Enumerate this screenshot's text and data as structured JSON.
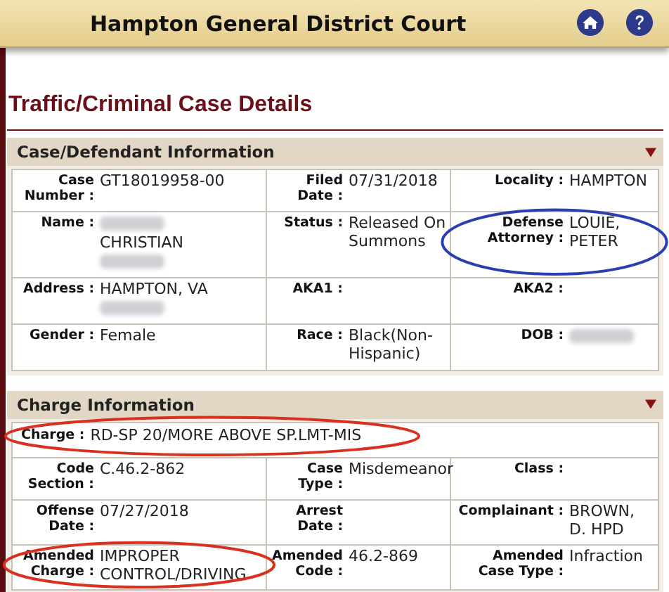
{
  "header": {
    "title": "Hampton General District Court"
  },
  "page_title": "Traffic/Criminal Case Details",
  "sections": [
    {
      "title": "Case/Defendant Information",
      "rows": [
        [
          {
            "label": "Case Number :",
            "value": [
              {
                "kind": "text",
                "text": "GT18019958-00"
              }
            ]
          },
          {
            "label": "Filed Date :",
            "value": [
              {
                "kind": "text",
                "text": "07/31/2018"
              }
            ]
          },
          {
            "label": "Locality :",
            "value": [
              {
                "kind": "text",
                "text": "HAMPTON"
              }
            ]
          }
        ],
        [
          {
            "label": "Name :",
            "value": [
              {
                "kind": "redacted"
              },
              {
                "kind": "text",
                "text": "CHRISTIAN"
              },
              {
                "kind": "redacted"
              }
            ]
          },
          {
            "label": "Status :",
            "value": [
              {
                "kind": "text",
                "text": "Released On Summons"
              }
            ]
          },
          {
            "label": "Defense Attorney :",
            "value": [
              {
                "kind": "text",
                "text": "LOUIE, PETER"
              }
            ],
            "circle": {
              "color": "#2b3fb0"
            }
          }
        ],
        [
          {
            "label": "Address :",
            "value": [
              {
                "kind": "text",
                "text": "HAMPTON, VA"
              },
              {
                "kind": "redacted"
              }
            ]
          },
          {
            "label": "AKA1 :"
          },
          {
            "label": "AKA2 :"
          }
        ],
        [
          {
            "label": "Gender :",
            "value": [
              {
                "kind": "text",
                "text": "Female"
              }
            ]
          },
          {
            "label": "Race :",
            "value": [
              {
                "kind": "text",
                "text": "Black(Non-Hispanic)"
              }
            ]
          },
          {
            "label": "DOB :",
            "value": [
              {
                "kind": "redacted"
              }
            ]
          }
        ]
      ]
    },
    {
      "title": "Charge Information",
      "charge": {
        "label": "Charge :",
        "value": [
          {
            "kind": "text",
            "text": "RD-SP 20/MORE ABOVE SP.LMT-MIS"
          }
        ],
        "circle": {
          "color": "#d9301f"
        }
      },
      "rows": [
        [
          {
            "label": "Code Section :",
            "value": [
              {
                "kind": "text",
                "text": "C.46.2-862"
              }
            ]
          },
          {
            "label": "Case Type :",
            "value": [
              {
                "kind": "text",
                "text": "Misdemeanor"
              }
            ]
          },
          {
            "label": "Class :"
          }
        ],
        [
          {
            "label": "Offense Date :",
            "value": [
              {
                "kind": "text",
                "text": "07/27/2018"
              }
            ]
          },
          {
            "label": "Arrest Date :"
          },
          {
            "label": "Complainant :",
            "value": [
              {
                "kind": "text",
                "text": "BROWN, D. HPD"
              }
            ]
          }
        ],
        [
          {
            "label": "Amended Charge :",
            "value": [
              {
                "kind": "text",
                "text": "IMPROPER CONTROL/DRIVING"
              }
            ],
            "circle": {
              "color": "#d9301f"
            }
          },
          {
            "label": "Amended Code :",
            "value": [
              {
                "kind": "text",
                "text": "46.2-869"
              }
            ]
          },
          {
            "label": "Amended Case Type :",
            "value": [
              {
                "kind": "text",
                "text": "Infraction"
              }
            ]
          }
        ]
      ]
    }
  ]
}
